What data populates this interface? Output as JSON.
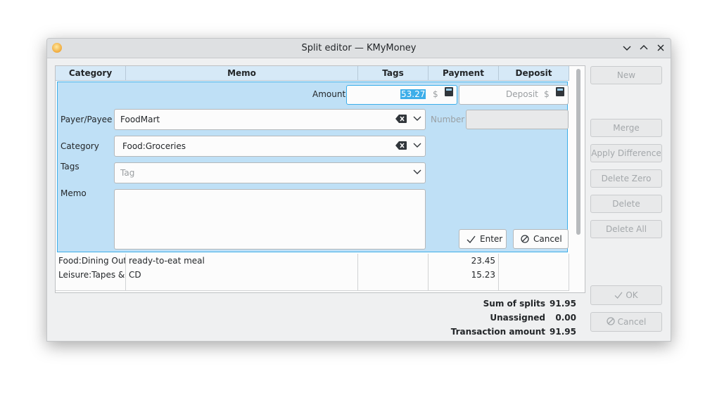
{
  "window": {
    "title": "Split editor — KMyMoney"
  },
  "table": {
    "headers": [
      "Category",
      "Memo",
      "Tags",
      "Payment",
      "Deposit"
    ],
    "rows": [
      {
        "category": "Food:Dining Out",
        "memo": "ready-to-eat meal",
        "tags": "",
        "payment": "23.45",
        "deposit": ""
      },
      {
        "category": "Leisure:Tapes & CDs",
        "memo": "CD",
        "tags": "",
        "payment": "15.23",
        "deposit": ""
      }
    ]
  },
  "editor": {
    "amount_label": "Amount",
    "amount_value": "53.27",
    "currency": "$",
    "deposit_placeholder": "Deposit",
    "payee_label": "Payer/Payee",
    "payee_value": "FoodMart",
    "number_label": "Number",
    "category_label": "Category",
    "category_value": "Food:Groceries",
    "tags_label": "Tags",
    "tags_placeholder": "Tag",
    "memo_label": "Memo",
    "enter_label": "Enter",
    "cancel_label": "Cancel"
  },
  "side_buttons": {
    "new": "New",
    "merge": "Merge",
    "apply_difference": "Apply Difference",
    "delete_zero": "Delete Zero",
    "delete": "Delete",
    "delete_all": "Delete All",
    "ok": "OK",
    "cancel": "Cancel"
  },
  "summary": {
    "sum_label": "Sum of splits",
    "sum_value": "91.95",
    "unassigned_label": "Unassigned",
    "unassigned_value": "0.00",
    "transaction_label": "Transaction amount",
    "transaction_value": "91.95"
  },
  "colors": {
    "accent": "#3daee9",
    "editor_bg": "#bfe0f6",
    "header_bg": "#d6e9f7"
  }
}
